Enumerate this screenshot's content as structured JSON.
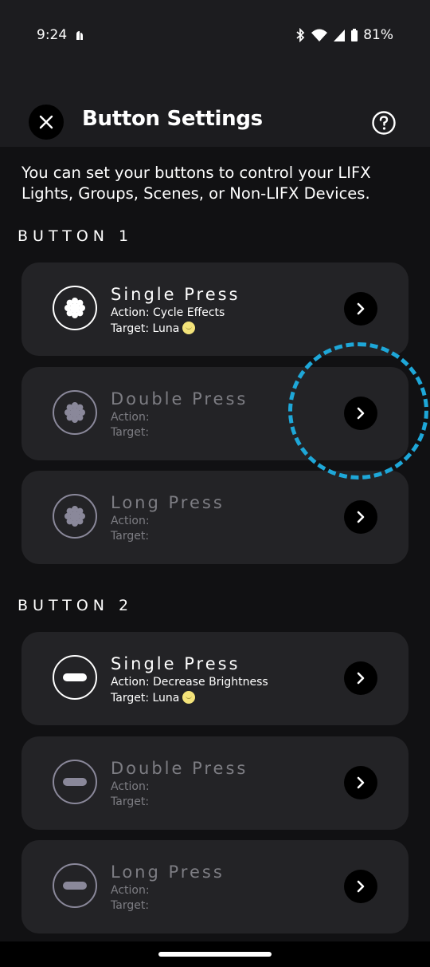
{
  "status": {
    "time": "9:24",
    "battery": "81%"
  },
  "header": {
    "title": "Button Settings"
  },
  "intro": "You can set your buttons to control your LIFX Lights, Groups, Scenes, or Non-LIFX Devices.",
  "sections": [
    {
      "label": "BUTTON 1",
      "icon": "asterisk-icon",
      "cards": [
        {
          "name": "Single Press",
          "action": "Action: Cycle Effects",
          "target": "Target: Luna"
        },
        {
          "name": "Double Press",
          "action": "Action:",
          "target": "Target:"
        },
        {
          "name": "Long Press",
          "action": "Action:",
          "target": "Target:"
        }
      ]
    },
    {
      "label": "BUTTON 2",
      "icon": "minus-icon",
      "cards": [
        {
          "name": "Single Press",
          "action": "Action: Decrease Brightness",
          "target": "Target: Luna"
        },
        {
          "name": "Double Press",
          "action": "Action:",
          "target": "Target:"
        },
        {
          "name": "Long Press",
          "action": "Action:",
          "target": "Target:"
        }
      ]
    }
  ],
  "colors": {
    "background": "#111113",
    "card": "#232326",
    "highlight": "#1ea7d8",
    "dim_text": "#7d7d83"
  }
}
